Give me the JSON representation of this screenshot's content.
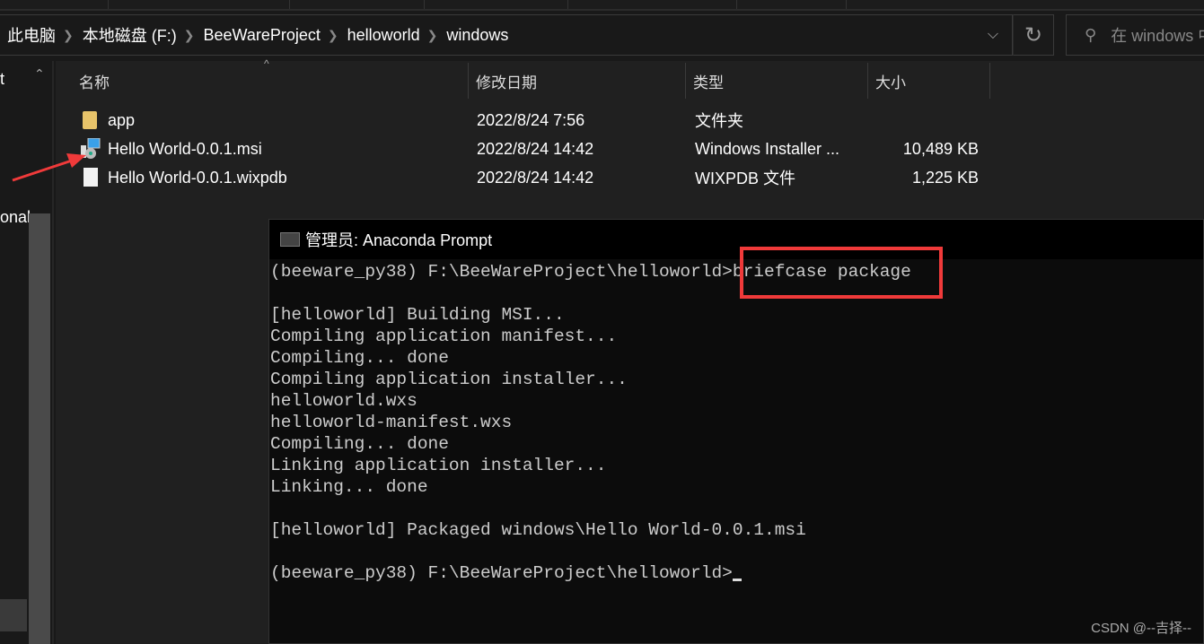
{
  "breadcrumb": [
    "此电脑",
    "本地磁盘 (F:)",
    "BeeWareProject",
    "helloworld",
    "windows"
  ],
  "search": {
    "placeholder": "在 windows 中搜索"
  },
  "nav": {
    "partial_labels": [
      "t",
      "onal"
    ]
  },
  "columns": [
    "名称",
    "修改日期",
    "类型",
    "大小"
  ],
  "files": [
    {
      "name": "app",
      "date": "2022/8/24 7:56",
      "type": "文件夹",
      "size": "",
      "icon": "folder-icon"
    },
    {
      "name": "Hello World-0.0.1.msi",
      "date": "2022/8/24 14:42",
      "type": "Windows Installer ...",
      "size": "10,489 KB",
      "icon": "msi-installer-icon"
    },
    {
      "name": "Hello World-0.0.1.wixpdb",
      "date": "2022/8/24 14:42",
      "type": "WIXPDB 文件",
      "size": "1,225 KB",
      "icon": "file-icon"
    }
  ],
  "terminal": {
    "title": "管理员: Anaconda Prompt",
    "prompt": "(beeware_py38) F:\\BeeWareProject\\helloworld>",
    "command": "briefcase package",
    "lines": [
      "",
      "[helloworld] Building MSI...",
      "Compiling application manifest...",
      "Compiling... done",
      "Compiling application installer...",
      "helloworld.wxs",
      "helloworld-manifest.wxs",
      "Compiling... done",
      "Linking application installer...",
      "Linking... done",
      "",
      "[helloworld] Packaged windows\\Hello World-0.0.1.msi",
      ""
    ]
  },
  "annotations": {
    "highlight_color": "#f03a3a"
  },
  "watermark": "CSDN @--吉择--"
}
